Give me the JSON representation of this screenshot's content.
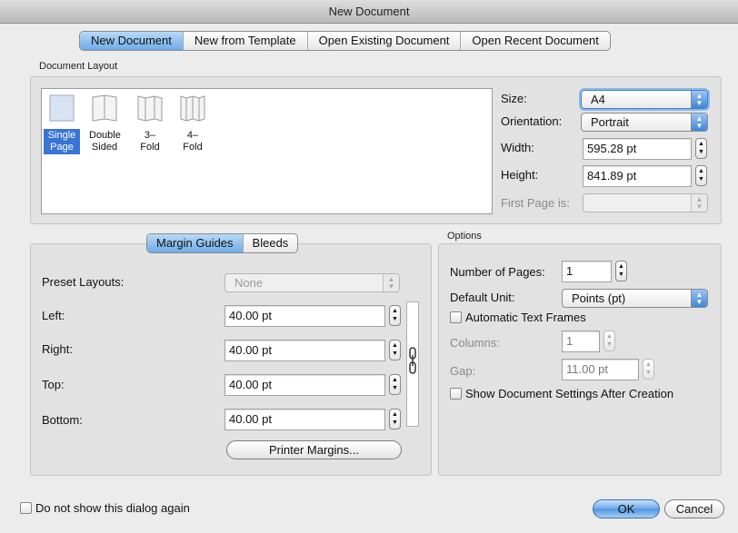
{
  "window": {
    "title": "New Document"
  },
  "tabs": [
    {
      "label": "New Document",
      "selected": true
    },
    {
      "label": "New from Template",
      "selected": false
    },
    {
      "label": "Open Existing Document",
      "selected": false
    },
    {
      "label": "Open Recent Document",
      "selected": false
    }
  ],
  "document_layout": {
    "group_label": "Document Layout",
    "items": [
      {
        "label_line1": "Single",
        "label_line2": "Page",
        "icon": "single-page-icon",
        "selected": true
      },
      {
        "label_line1": "Double",
        "label_line2": "Sided",
        "icon": "double-sided-icon",
        "selected": false
      },
      {
        "label_line1": "3–",
        "label_line2": "Fold",
        "icon": "three-fold-icon",
        "selected": false
      },
      {
        "label_line1": "4–",
        "label_line2": "Fold",
        "icon": "four-fold-icon",
        "selected": false
      }
    ],
    "size": {
      "label": "Size:",
      "value": "A4"
    },
    "orientation": {
      "label": "Orientation:",
      "value": "Portrait"
    },
    "width": {
      "label": "Width:",
      "value": "595.28 pt"
    },
    "height": {
      "label": "Height:",
      "value": "841.89 pt"
    },
    "first_page": {
      "label": "First Page is:",
      "value": ""
    }
  },
  "margins": {
    "segments": [
      {
        "label": "Margin Guides",
        "selected": true
      },
      {
        "label": "Bleeds",
        "selected": false
      }
    ],
    "preset": {
      "label": "Preset Layouts:",
      "value": "None"
    },
    "left": {
      "label": "Left:",
      "value": "40.00 pt"
    },
    "right": {
      "label": "Right:",
      "value": "40.00 pt"
    },
    "top": {
      "label": "Top:",
      "value": "40.00 pt"
    },
    "bottom": {
      "label": "Bottom:",
      "value": "40.00 pt"
    },
    "printer_margins_button": "Printer Margins..."
  },
  "options": {
    "group_label": "Options",
    "num_pages": {
      "label": "Number of Pages:",
      "value": "1"
    },
    "default_unit": {
      "label": "Default Unit:",
      "value": "Points (pt)"
    },
    "auto_text_frames": {
      "label": "Automatic Text Frames",
      "checked": false
    },
    "columns": {
      "label": "Columns:",
      "value": "1"
    },
    "gap": {
      "label": "Gap:",
      "value": "11.00 pt"
    },
    "show_settings": {
      "label": "Show Document Settings After Creation",
      "checked": false
    }
  },
  "footer": {
    "dont_show_label": "Do not show this dialog again",
    "ok_label": "OK",
    "cancel_label": "Cancel"
  },
  "colors": {
    "accent": "#3875d7",
    "default_button": "#6aa8e8"
  }
}
